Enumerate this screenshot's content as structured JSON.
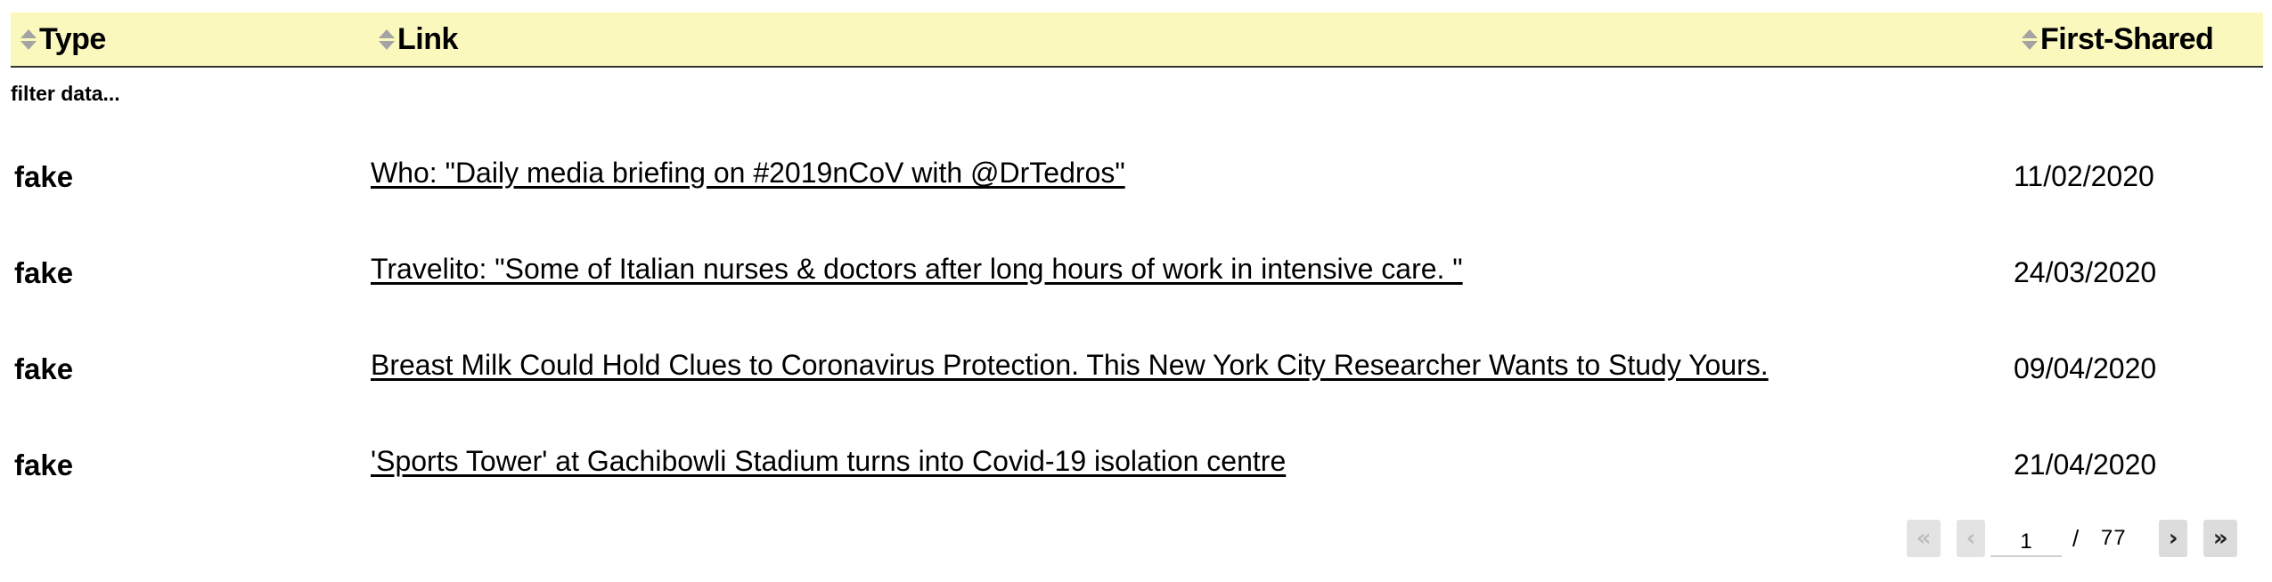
{
  "table": {
    "columns": [
      {
        "label": "Type",
        "sort_icon": "sort-icon"
      },
      {
        "label": "Link",
        "sort_icon": "sort-icon"
      },
      {
        "label": "First-Shared",
        "sort_icon": "sort-icon"
      }
    ],
    "filter_placeholder": "filter data...",
    "rows": [
      {
        "type": "fake",
        "link": "Who: \"Daily media briefing on #2019nCoV with @DrTedros\"",
        "first_shared": "11/02/2020"
      },
      {
        "type": "fake",
        "link": "Travelito: \"Some of Italian nurses & doctors after long hours of work in intensive care. \"",
        "first_shared": "24/03/2020"
      },
      {
        "type": "fake",
        "link": "Breast Milk Could Hold Clues to Coronavirus Protection. This New York City Researcher Wants to Study Yours.",
        "first_shared": "09/04/2020"
      },
      {
        "type": "fake",
        "link": "'Sports Tower' at Gachibowli Stadium turns into Covid-19 isolation centre",
        "first_shared": "21/04/2020"
      }
    ]
  },
  "pager": {
    "first_icon": "«",
    "prev_icon": "‹",
    "current_page": "1",
    "separator": "/",
    "total_pages": "77",
    "next_icon": "›",
    "last_icon": "»"
  },
  "colors": {
    "header_bg": "#fbf8bd",
    "button_bg": "#e3e3e3"
  }
}
